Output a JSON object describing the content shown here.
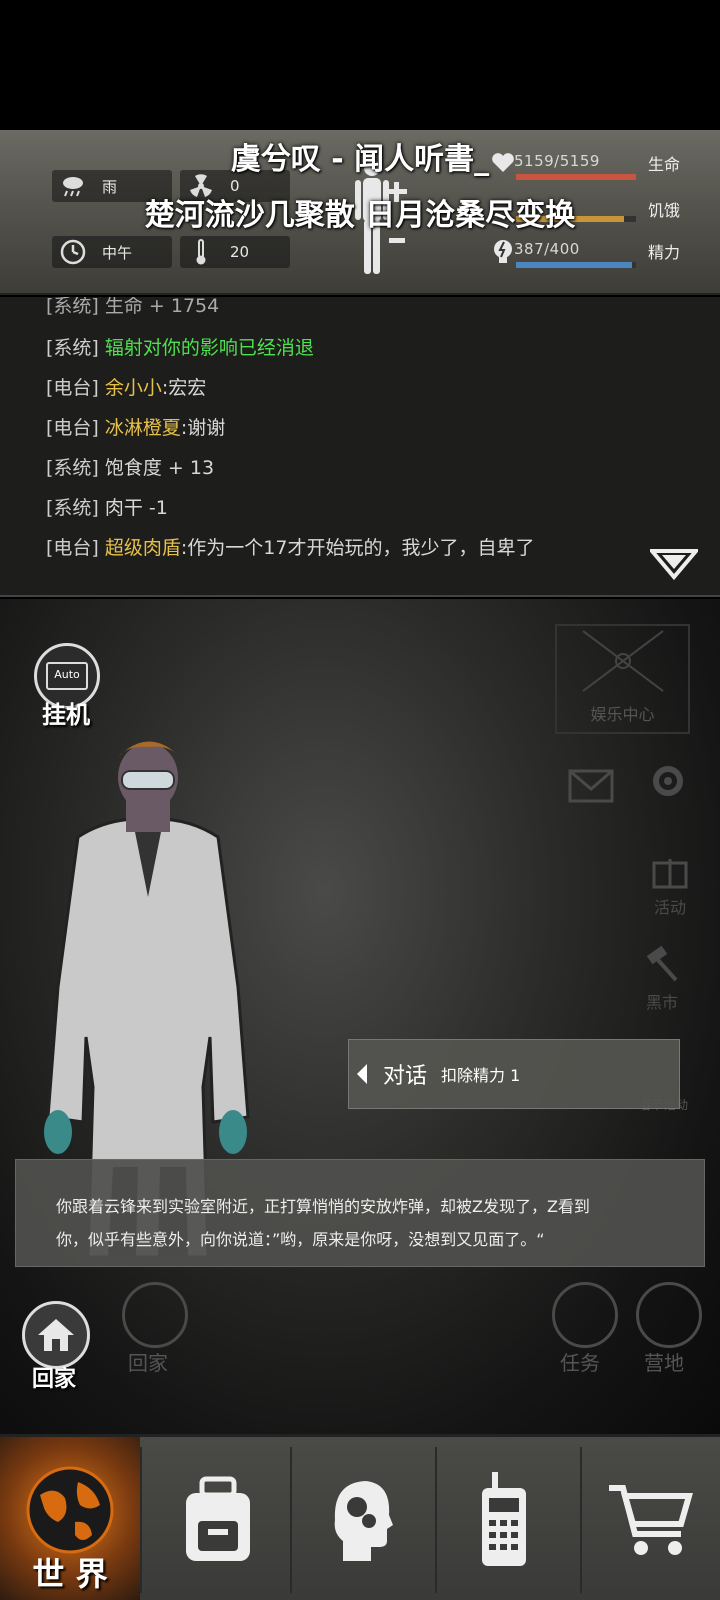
{
  "status": {
    "weather": "雨",
    "radiation": "0",
    "time_of_day": "中午",
    "temperature": "20",
    "health": {
      "text": "5159/5159",
      "label": "生命",
      "fraction": 1.0,
      "color": "#c9553f"
    },
    "hunger": {
      "label": "饥饿",
      "fraction": 0.9,
      "color": "#c9953a"
    },
    "energy": {
      "text": "387/400",
      "label": "精力",
      "fraction": 0.9675,
      "color": "#4a86c0"
    }
  },
  "lyrics": {
    "line1": "虞兮叹 - 闻人听書_",
    "line2": "楚河流沙几聚散 日月沧桑尽变换"
  },
  "log": {
    "partial_top": "[系统] 生命 + 1754",
    "lines": [
      {
        "tag": "[系统]",
        "name": "",
        "msg": "辐射对你的影响已经消退",
        "green": true
      },
      {
        "tag": "[电台]",
        "name": "余小小",
        "msg": ":宏宏",
        "green": false
      },
      {
        "tag": "[电台]",
        "name": "冰淋橙夏",
        "msg": ":谢谢",
        "green": false
      },
      {
        "tag": "[系统]",
        "name": "",
        "msg": "饱食度 + 13",
        "green": false
      },
      {
        "tag": "[系统]",
        "name": "",
        "msg": "肉干 -1",
        "green": false
      },
      {
        "tag": "[电台]",
        "name": "超级肉盾",
        "msg": ":作为一个17才开始玩的，我少了，自卑了",
        "green": false
      }
    ]
  },
  "scene": {
    "auto_label": "Auto",
    "idle_label": "挂机",
    "entertainment": "娱乐中心",
    "activity": "活动",
    "black_market": "黑市",
    "spring_event": "春节活动",
    "home_label": "回家",
    "home_ghost": "回家",
    "task_label": "任务",
    "camp_label": "营地"
  },
  "dialog": {
    "option_label": "对话",
    "option_cost": "扣除精力 1"
  },
  "story": {
    "line1": "你跟着云锋来到实验室附近，正打算悄悄的安放炸弹，却被Z发现了，Z看到",
    "line2": "你，似乎有些意外，向你说道：”哟，原来是你呀，没想到又见面了。“"
  },
  "nav": {
    "world_label": "世 界",
    "items": [
      "globe-icon",
      "backpack-icon",
      "skills-head-icon",
      "radio-icon",
      "shop-cart-icon"
    ]
  }
}
